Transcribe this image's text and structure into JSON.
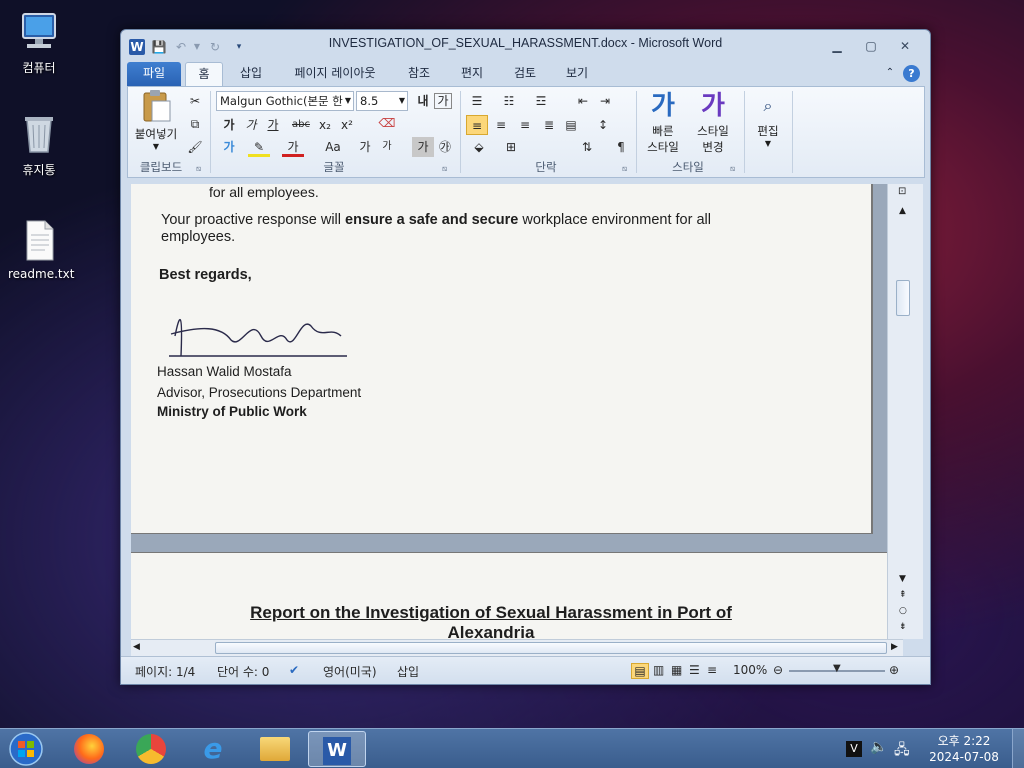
{
  "desktop": {
    "icons": [
      {
        "label": "컴퓨터",
        "icon": "computer-icon"
      },
      {
        "label": "휴지통",
        "icon": "recycle-bin-icon"
      },
      {
        "label": "readme.txt",
        "icon": "text-file-icon"
      }
    ]
  },
  "window": {
    "title": "INVESTIGATION_OF_SEXUAL_HARASSMENT.docx  -  Microsoft Word",
    "app_icon": "W"
  },
  "tabs": [
    "파일",
    "홈",
    "삽입",
    "페이지 레이아웃",
    "참조",
    "편지",
    "검토",
    "보기"
  ],
  "ribbon": {
    "clipboard": {
      "paste": "붙여넣기",
      "group": "클립보드"
    },
    "font": {
      "name": "Malgun Gothic(본문 한",
      "size": "8.5",
      "group": "글꼴",
      "bold": "가",
      "italic": "가",
      "underline": "가",
      "strike": "abc",
      "sub": "x₂",
      "sup": "x²",
      "grow": "가",
      "shrink": "가",
      "case": "Aa",
      "charborder": "가",
      "circled": "㉮",
      "clear": "가",
      "grow_k": "내",
      "shrink_k": "가"
    },
    "paragraph": {
      "group": "단락"
    },
    "styles": {
      "quick": "빠른",
      "quick2": "스타일",
      "change": "스타일",
      "change2": "변경",
      "group": "스타일"
    },
    "edit": {
      "label": "편집"
    }
  },
  "document": {
    "line_top": "for all employees.",
    "para_a": "Your proactive response will ",
    "para_b": "ensure a safe and secure",
    "para_c": " workplace environment for all",
    "para_d": "employees.",
    "closing": "Best regards,",
    "name": "Hassan Walid Mostafa",
    "role": "Advisor, Prosecutions Department",
    "org": "Ministry of Public Work",
    "heading": "Report on the Investigation of Sexual Harassment in Port of",
    "heading2": "Alexandria"
  },
  "status": {
    "page": "페이지: 1/4",
    "words": "단어 수: 0",
    "lang": "영어(미국)",
    "mode": "삽입",
    "zoom": "100%"
  },
  "taskbar": {
    "time": "오후 2:22",
    "date": "2024-07-08"
  }
}
